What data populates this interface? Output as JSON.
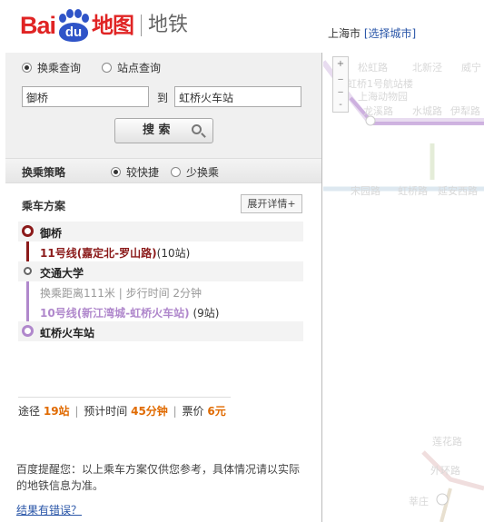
{
  "header": {
    "logo_bai": "Bai",
    "logo_du": "du",
    "logo_ditu": "地图",
    "logo_product": "地铁",
    "city_name": "上海市",
    "city_link": "[选择城市]"
  },
  "search": {
    "mode_transfer": "换乘查询",
    "mode_station": "站点查询",
    "from_value": "御桥",
    "to_label": "到",
    "to_value": "虹桥火车站",
    "button_label": "搜 索"
  },
  "strategy": {
    "label": "换乘策略",
    "option_fast": "较快捷",
    "option_less_transfer": "少换乘",
    "selected": "较快捷"
  },
  "plan": {
    "title": "乘车方案",
    "expand_label": "展开详情+",
    "start_station": "御桥",
    "leg1_line": "11号线(嘉定北-罗山路)",
    "leg1_stops": "(10站)",
    "transfer_station": "交通大学",
    "transfer_info": "换乘距离111米 | 步行时间 2分钟",
    "leg2_line": "10号线(新江湾城-虹桥火车站)",
    "leg2_stops": "(9站)",
    "end_station": "虹桥火车站",
    "summary_pass_label": "途径",
    "summary_pass_value": "19站",
    "summary_time_label": "预计时间",
    "summary_time_value": "45分钟",
    "summary_fare_label": "票价",
    "summary_fare_value": "6元"
  },
  "notice": {
    "text": "百度提醒您：以上乘车方案仅供您参考，具体情况请以实际的地铁信息为准。",
    "feedback_link": "结果有错误？"
  },
  "map": {
    "labels": [
      "松虹路",
      "北新泾",
      "威宁",
      "虹桥1号航站楼",
      "上海动物园",
      "龙溪路",
      "水城路",
      "伊犁路",
      "宋园路",
      "虹桥路",
      "延安西路",
      "中山公园",
      "莲花路",
      "外环路",
      "莘庄"
    ]
  },
  "colors": {
    "line11": "#8b1a1a",
    "line10": "#b088cc",
    "accent_orange": "#e06a00",
    "link_blue": "#2a56a8"
  }
}
